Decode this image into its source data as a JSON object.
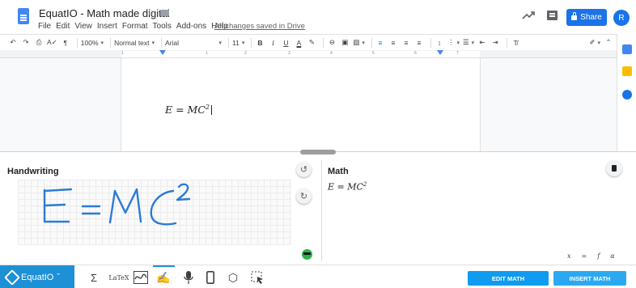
{
  "titlebar": {
    "doc_title": "EquatIO - Math made digital",
    "saved_status": "All changes saved in Drive",
    "menu": [
      "File",
      "Edit",
      "View",
      "Insert",
      "Format",
      "Tools",
      "Add-ons",
      "Help"
    ],
    "share_label": "Share",
    "avatar_initial": "R"
  },
  "toolbar": {
    "zoom": "100%",
    "style": "Normal text",
    "font": "Arial",
    "font_size": "11",
    "bold": "B",
    "italic": "I",
    "underline": "U",
    "text_color": "A"
  },
  "ruler": {
    "ticks": [
      "1",
      "1",
      "2",
      "3",
      "4",
      "5",
      "6",
      "7"
    ]
  },
  "document": {
    "formula": "E = MC",
    "exponent": "2"
  },
  "equatio": {
    "handwriting_title": "Handwriting",
    "math_title": "Math",
    "math_expression": "E = MC",
    "math_exponent": "2",
    "math_tools": [
      "x",
      "=",
      "f",
      "α"
    ],
    "edit_button": "EDIT MATH",
    "insert_button": "INSERT MATH",
    "logo_text": "EquatIO"
  },
  "colors": {
    "accent": "#1e90d6",
    "share": "#1a73e8",
    "ink": "#2b7bd6"
  },
  "icons": [
    "undo-icon",
    "redo-icon",
    "print-icon",
    "spellcheck-icon",
    "paint-format-icon",
    "link-icon",
    "comment-add-icon",
    "image-icon",
    "align-left-icon",
    "align-center-icon",
    "align-right-icon",
    "justify-icon",
    "line-spacing-icon",
    "numbered-list-icon",
    "bulleted-list-icon",
    "decrease-indent-icon",
    "increase-indent-icon",
    "clear-format-icon",
    "pen-icon",
    "collapse-icon",
    "sigma-icon",
    "latex-icon",
    "graph-icon",
    "handwriting-icon",
    "mic-icon",
    "phone-icon",
    "3d-icon",
    "screenshot-icon"
  ]
}
